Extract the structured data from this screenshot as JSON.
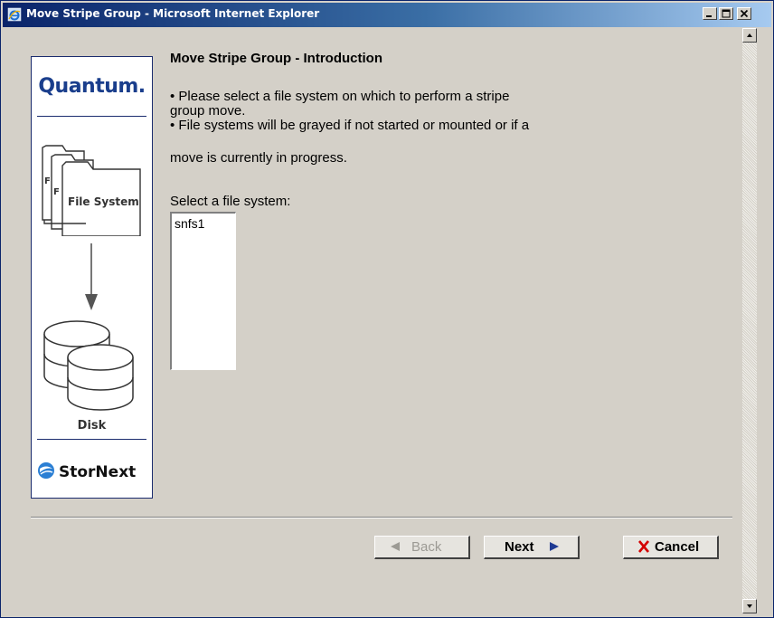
{
  "window": {
    "title": "Move Stripe Group - Microsoft Internet Explorer",
    "controls": {
      "minimize": "_",
      "maximize": "□",
      "close": "×"
    }
  },
  "branding": {
    "logo": "Quantum.",
    "file_system_label": "File System",
    "disk_label": "Disk",
    "product": "StorNext"
  },
  "main": {
    "heading": "Move Stripe Group - Introduction",
    "bullet1_line1": "•  Please select a file system on which to perform a stripe",
    "bullet1_line2": "group move.",
    "bullet2_line1": "•  File systems will be grayed if not started or mounted or if a",
    "bullet2_line2": "move is currently in progress.",
    "select_label": "Select a file system:",
    "file_systems": [
      "snfs1"
    ]
  },
  "buttons": {
    "back": "Back",
    "next": "Next",
    "cancel": "Cancel"
  },
  "colors": {
    "titlebar_start": "#0a246a",
    "titlebar_end": "#a6caf0",
    "panel_border": "#1b2c6e",
    "quantum_blue": "#1a3e8c",
    "cancel_x": "#d40000",
    "arrow_blue": "#1f3a93"
  }
}
